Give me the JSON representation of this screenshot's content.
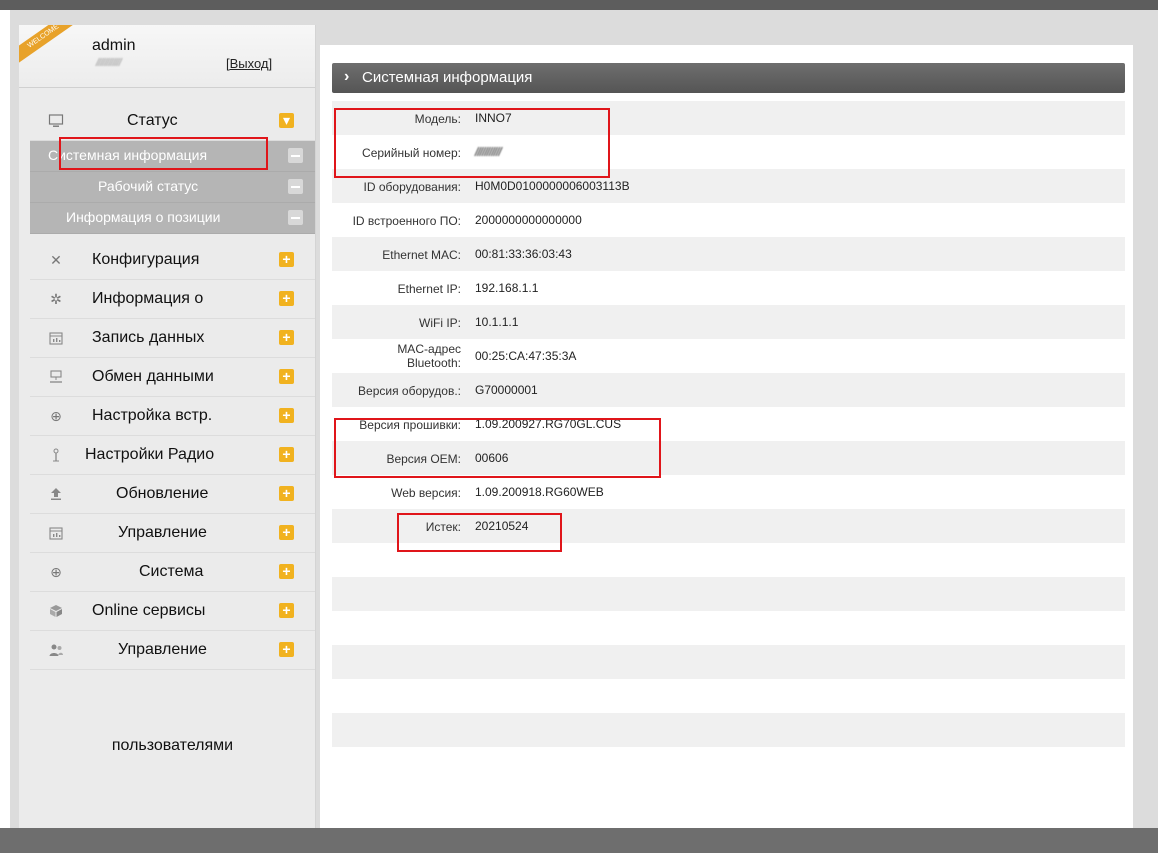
{
  "user": {
    "welcome_badge": "WELCOME",
    "name": "admin",
    "blurred_info": "////////////",
    "logout_label": "[Выход]"
  },
  "sidebar": {
    "items": [
      {
        "label": "Статус",
        "icon": "monitor-icon",
        "expanded": true
      },
      {
        "label": "Конфигурация",
        "icon": "tools-icon"
      },
      {
        "label": "Информация о",
        "icon": "satellite-icon"
      },
      {
        "label": "Запись данных",
        "icon": "calendar-chart-icon"
      },
      {
        "label": "Обмен данными",
        "icon": "network-icon"
      },
      {
        "label": "Настройка встр.",
        "icon": "globe-icon"
      },
      {
        "label": "Настройки Радио",
        "icon": "antenna-icon"
      },
      {
        "label": "Обновление",
        "icon": "upload-icon"
      },
      {
        "label": "Управление",
        "icon": "calendar-chart-icon"
      },
      {
        "label": "Система",
        "icon": "globe-icon"
      },
      {
        "label": "Online сервисы",
        "icon": "cloud-box-icon"
      },
      {
        "label": "Управление",
        "icon": "users-icon"
      }
    ],
    "status_subitems": [
      {
        "label": "Системная информация",
        "active": true
      },
      {
        "label": "Рабочий статус"
      },
      {
        "label": "Информация о позиции"
      }
    ],
    "tail_label": "пользователями"
  },
  "section": {
    "title": "Системная информация"
  },
  "info_rows": [
    {
      "key": "Модель:",
      "value": "INNO7"
    },
    {
      "key": "Серийный номер:",
      "value": "///////////",
      "blurred": true
    },
    {
      "key": "ID оборудования:",
      "value": "H0M0D0100000006003113B"
    },
    {
      "key": "ID встроенного ПО:",
      "value": "2000000000000000"
    },
    {
      "key": "Ethernet MAC:",
      "value": "00:81:33:36:03:43"
    },
    {
      "key": "Ethernet IP:",
      "value": "192.168.1.1"
    },
    {
      "key": "WiFi IP:",
      "value": "10.1.1.1"
    },
    {
      "key": "MAC-адрес Bluetooth:",
      "value": "00:25:CA:47:35:3A"
    },
    {
      "key": "Версия оборудов.:",
      "value": "G70000001"
    },
    {
      "key": "Версия прошивки:",
      "value": "1.09.200927.RG70GL.CUS"
    },
    {
      "key": "Версия OEM:",
      "value": "00606"
    },
    {
      "key": "Web версия:",
      "value": "1.09.200918.RG60WEB"
    },
    {
      "key": "Истек:",
      "value": "20210524"
    }
  ],
  "colors": {
    "accent_plus": "#f1b21f",
    "highlight_border": "#e0151a",
    "header_bg": "#5f5f5f",
    "subitem_bg": "#b5b5b5"
  }
}
